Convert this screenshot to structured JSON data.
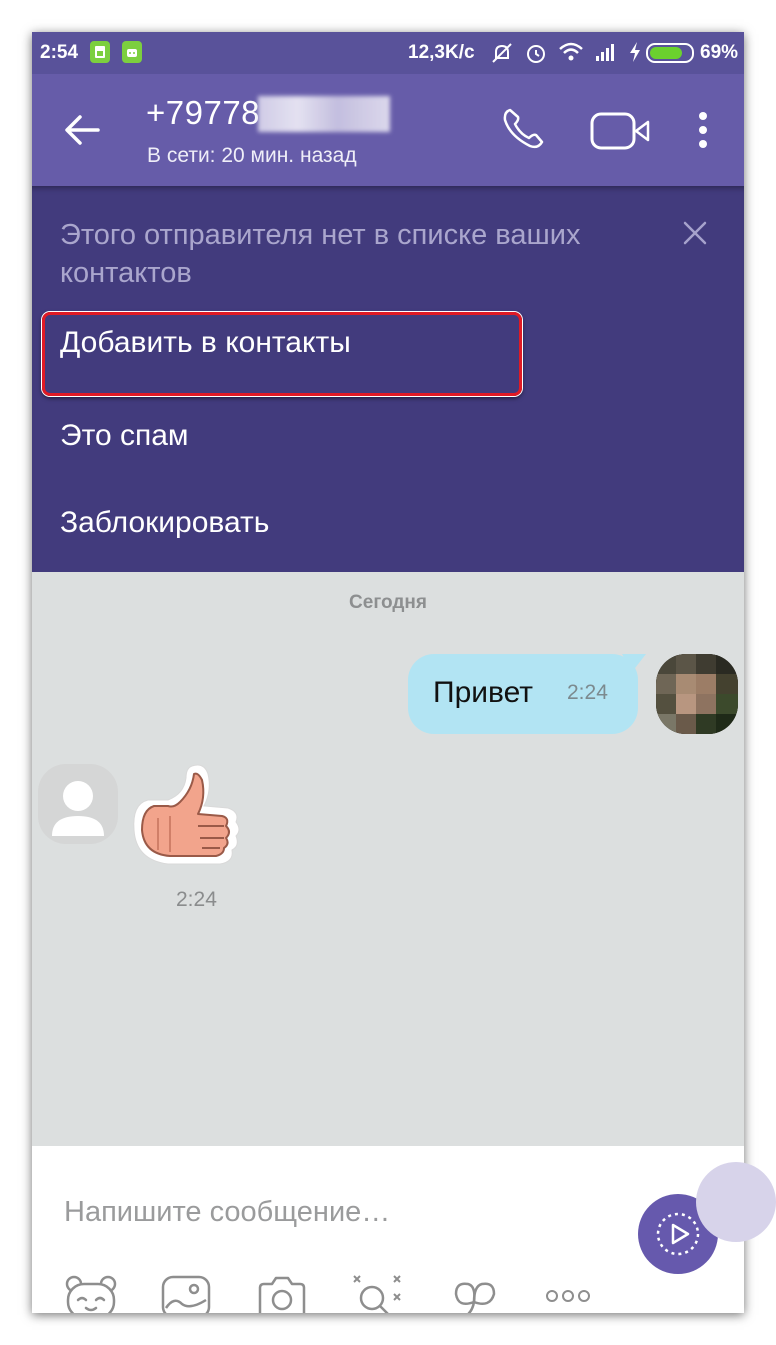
{
  "status_bar": {
    "time": "2:54",
    "net_speed": "12,3K/c",
    "battery_percent": "69%"
  },
  "header": {
    "title": "+79778",
    "last_seen": "В сети: 20 мин. назад",
    "icons": [
      "back-arrow-icon",
      "phone-icon",
      "video-call-icon",
      "more-vertical-icon"
    ]
  },
  "banner": {
    "message": "Этого отправителя нет в списке ваших контактов",
    "options": [
      "Добавить в контакты",
      "Это спам",
      "Заблокировать"
    ],
    "highlight_color": "#e01a25"
  },
  "chat": {
    "date_separator": "Сегодня",
    "outgoing": {
      "text": "Привет",
      "time": "2:24"
    },
    "incoming_sticker": {
      "time": "2:24",
      "icon": "thumbs-up-sticker"
    }
  },
  "composer": {
    "placeholder": "Напишите сообщение…",
    "toolbar_icons": [
      "sticker-bear-icon",
      "gallery-icon",
      "camera-icon",
      "doodle-icon",
      "gif-icon",
      "more-horizontal-icon"
    ]
  },
  "colors": {
    "header": "#665ca9",
    "banner": "#423b7d",
    "bubble_out": "#b2e4f3",
    "chat_bg": "#dcdfdf",
    "accent": "#6659ad"
  }
}
